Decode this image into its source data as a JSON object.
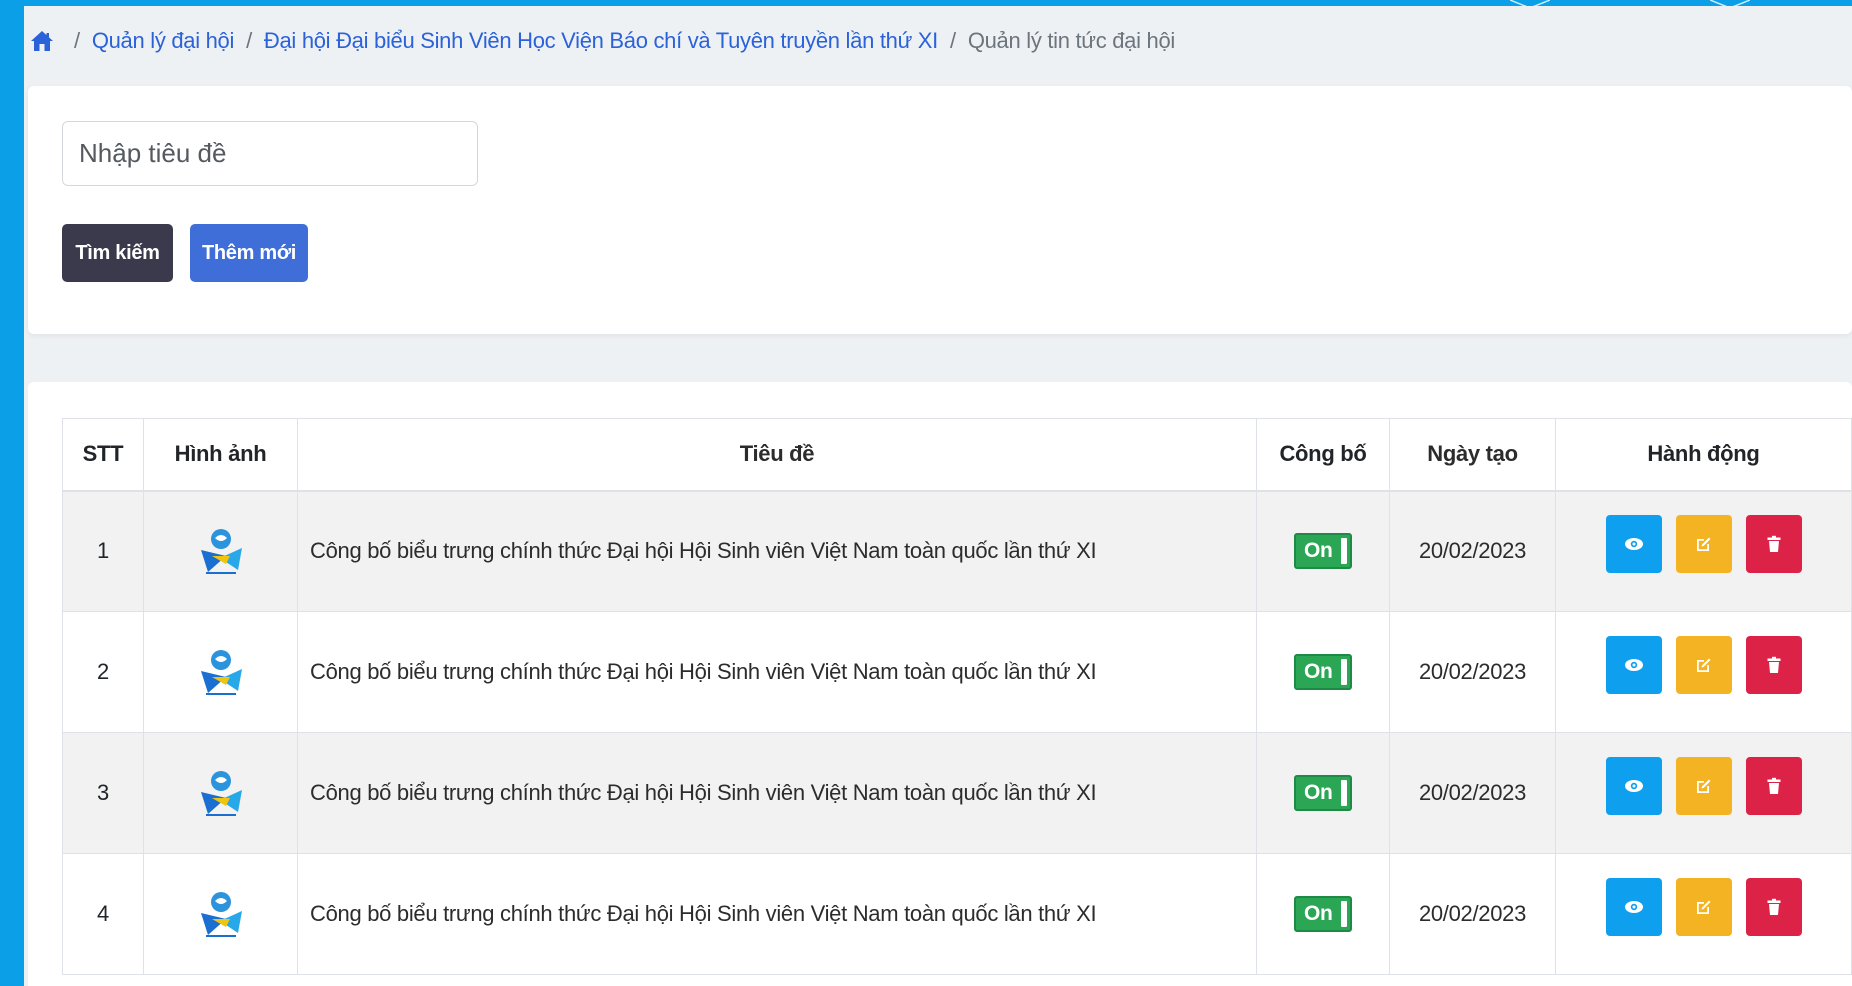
{
  "breadcrumb": {
    "home_icon": "home-icon",
    "items": [
      "Quản lý đại hội",
      "Đại hội Đại biểu Sinh Viên Học Viện Báo chí và Tuyên truyền lần thứ XI",
      "Quản lý tin tức đại hội"
    ]
  },
  "search": {
    "placeholder": "Nhập tiêu đề",
    "value": ""
  },
  "buttons": {
    "search_label": "Tìm kiếm",
    "add_label": "Thêm mới"
  },
  "table": {
    "headers": [
      "STT",
      "Hình ảnh",
      "Tiêu đề",
      "Công bố",
      "Ngày tạo",
      "Hành động"
    ],
    "rows": [
      {
        "stt": "1",
        "title": "Công bố biểu trưng chính thức Đại hội Hội Sinh viên Việt Nam toàn quốc lần thứ XI",
        "published": "On",
        "date": "20/02/2023"
      },
      {
        "stt": "2",
        "title": "Công bố biểu trưng chính thức Đại hội Hội Sinh viên Việt Nam toàn quốc lần thứ XI",
        "published": "On",
        "date": "20/02/2023"
      },
      {
        "stt": "3",
        "title": "Công bố biểu trưng chính thức Đại hội Hội Sinh viên Việt Nam toàn quốc lần thứ XI",
        "published": "On",
        "date": "20/02/2023"
      },
      {
        "stt": "4",
        "title": "Công bố biểu trưng chính thức Đại hội Hội Sinh viên Việt Nam toàn quốc lần thứ XI",
        "published": "On",
        "date": "20/02/2023"
      }
    ],
    "action_icons": [
      "eye-icon",
      "edit-icon",
      "trash-icon"
    ]
  },
  "colors": {
    "frame": "#0a9fe6",
    "link": "#2b62d9",
    "search_button": "#3a3a4c",
    "add_button": "#3f6ed8",
    "toggle_on": "#2aa655",
    "view": "#0ea0ee",
    "edit": "#f4b322",
    "delete": "#dc2246"
  }
}
